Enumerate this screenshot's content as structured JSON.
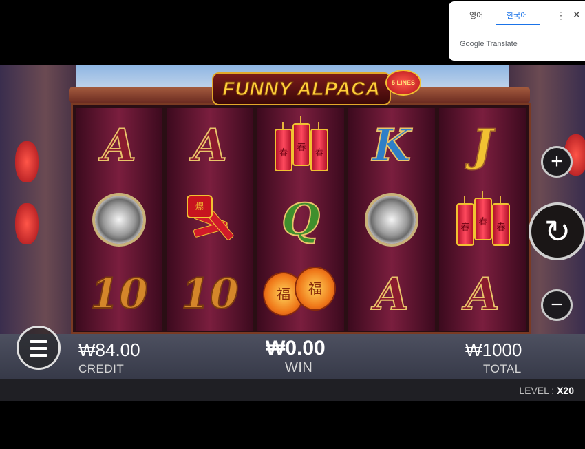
{
  "translate_popup": {
    "tab_source": "영어",
    "tab_target": "한국어",
    "more_icon": "more-vert-icon",
    "close_icon": "close-icon",
    "brand": "Google Translate"
  },
  "game": {
    "title": "FUNNY ALPACA",
    "lines_badge": "5 LINES",
    "reels": [
      [
        "A",
        "gong",
        "10"
      ],
      [
        "A",
        "firecracker-burst",
        "10"
      ],
      [
        "firecrackers",
        "Q",
        "lanterns"
      ],
      [
        "K",
        "gong",
        "A"
      ],
      [
        "J",
        "firecrackers",
        "A"
      ]
    ],
    "credit_value": "₩84.00",
    "credit_label": "CREDIT",
    "win_value": "₩0.00",
    "win_label": "WIN",
    "total_value": "₩1000",
    "total_label": "TOTAL",
    "level_label": "LEVEL :",
    "level_value": "X20",
    "plus_icon": "plus-icon",
    "minus_icon": "minus-icon",
    "spin_icon": "spin-refresh-icon",
    "menu_icon": "hamburger-menu-icon"
  }
}
